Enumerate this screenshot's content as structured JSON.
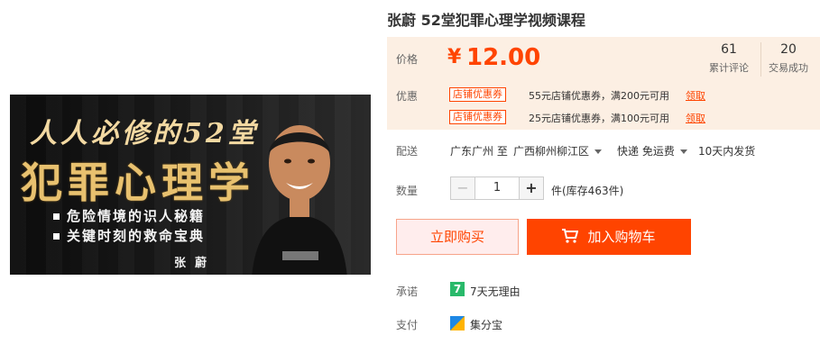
{
  "product": {
    "title": "张蔚 52堂犯罪心理学视频课程",
    "image": {
      "line1": "人人必修的52堂",
      "line2": "犯罪心理学",
      "bullet1": "危险情境的识人秘籍",
      "bullet2": "关键时刻的救命宝典",
      "author": "张蔚"
    }
  },
  "price": {
    "label": "价格",
    "currency": "¥",
    "value": "12.00",
    "reviews_count": "61",
    "reviews_label": "累计评论",
    "deals_count": "20",
    "deals_label": "交易成功"
  },
  "promo": {
    "label": "优惠",
    "coupons": [
      {
        "tag": "店铺优惠券",
        "desc": "55元店铺优惠券，满200元可用",
        "action": "领取"
      },
      {
        "tag": "店铺优惠券",
        "desc": "25元店铺优惠券，满100元可用",
        "action": "领取"
      }
    ]
  },
  "delivery": {
    "label": "配送",
    "from": "广东广州 至",
    "to": "广西柳州柳江区",
    "shipping": "快递 免运费",
    "dispatch": "10天内发货"
  },
  "quantity": {
    "label": "数量",
    "minus": "−",
    "value": "1",
    "plus": "+",
    "stock": "件(库存463件)"
  },
  "actions": {
    "buy_now": "立即购买",
    "add_cart": "加入购物车"
  },
  "promise": {
    "label": "承诺",
    "badge": "7",
    "text": "7天无理由"
  },
  "payment": {
    "label": "支付",
    "text": "集分宝"
  },
  "colors": {
    "accent": "#ff4400",
    "price_bg": "#fcefe3",
    "badge_green": "#29b96a"
  }
}
